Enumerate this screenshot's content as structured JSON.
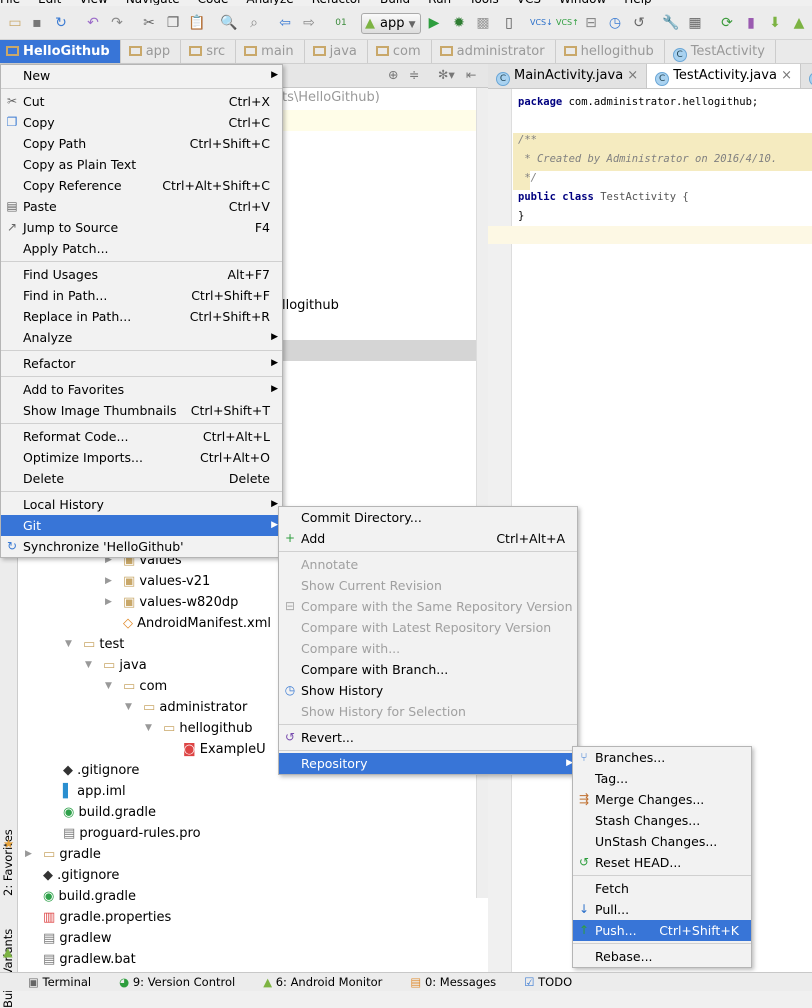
{
  "menubar": [
    "File",
    "Edit",
    "View",
    "Navigate",
    "Code",
    "Analyze",
    "Refactor",
    "Build",
    "Run",
    "Tools",
    "VCS",
    "Window",
    "Help"
  ],
  "toolbar": {
    "run_config": "app"
  },
  "breadcrumb": [
    "HelloGithub",
    "app",
    "src",
    "main",
    "java",
    "com",
    "administrator",
    "hellogithub",
    "TestActivity"
  ],
  "editor": {
    "tabs": [
      {
        "label": "MainActivity.java",
        "active": false
      },
      {
        "label": "TestActivity.java",
        "active": true
      },
      {
        "label": "c",
        "active": false
      }
    ],
    "lines": {
      "pkg_kw": "package",
      "pkg": " com.administrator.hellogithub;",
      "c1": "/**",
      "c2": " * Created by Administrator on 2016/4/10.",
      "c3": " */",
      "pub": "public",
      "cls": "class",
      "name": " TestActivity {",
      "close": "}"
    }
  },
  "project": {
    "path_fragment": "ts\\HelloGithub)",
    "pkg_fragment": "llogithub",
    "tree": [
      {
        "label": "values",
        "type": "res-folder",
        "depth": 5,
        "arrow": "right"
      },
      {
        "label": "values-v21",
        "type": "res-folder",
        "depth": 5,
        "arrow": "right"
      },
      {
        "label": "values-w820dp",
        "type": "res-folder",
        "depth": 5,
        "arrow": "right"
      },
      {
        "label": "AndroidManifest.xml",
        "type": "xml",
        "depth": 5
      },
      {
        "label": "test",
        "type": "folder",
        "depth": 3,
        "arrow": "down"
      },
      {
        "label": "java",
        "type": "folder",
        "depth": 4,
        "arrow": "down"
      },
      {
        "label": "com",
        "type": "folder",
        "depth": 5,
        "arrow": "down"
      },
      {
        "label": "administrator",
        "type": "folder",
        "depth": 6,
        "arrow": "down"
      },
      {
        "label": "hellogithub",
        "type": "folder",
        "depth": 7,
        "arrow": "down"
      },
      {
        "label": "ExampleU",
        "type": "test-class",
        "depth": 8
      },
      {
        "label": ".gitignore",
        "type": "git",
        "depth": 2
      },
      {
        "label": "app.iml",
        "type": "iml",
        "depth": 2
      },
      {
        "label": "build.gradle",
        "type": "gradle",
        "depth": 2
      },
      {
        "label": "proguard-rules.pro",
        "type": "file",
        "depth": 2
      },
      {
        "label": "gradle",
        "type": "folder",
        "depth": 1,
        "arrow": "right"
      },
      {
        "label": ".gitignore",
        "type": "git",
        "depth": 1
      },
      {
        "label": "build.gradle",
        "type": "gradle",
        "depth": 1
      },
      {
        "label": "gradle.properties",
        "type": "props",
        "depth": 1
      },
      {
        "label": "gradlew",
        "type": "file",
        "depth": 1
      },
      {
        "label": "gradlew.bat",
        "type": "file",
        "depth": 1
      }
    ]
  },
  "side_tabs": {
    "favorites": "2: Favorites",
    "build_variants": "Build Variants"
  },
  "context_menu": [
    {
      "label": "New",
      "submenu": true
    },
    "-",
    {
      "label": "Cut",
      "shortcut": "Ctrl+X",
      "icon": "scissors-icon"
    },
    {
      "label": "Copy",
      "shortcut": "Ctrl+C",
      "icon": "copy-icon"
    },
    {
      "label": "Copy Path",
      "shortcut": "Ctrl+Shift+C"
    },
    {
      "label": "Copy as Plain Text"
    },
    {
      "label": "Copy Reference",
      "shortcut": "Ctrl+Alt+Shift+C"
    },
    {
      "label": "Paste",
      "shortcut": "Ctrl+V",
      "icon": "paste-icon"
    },
    {
      "label": "Jump to Source",
      "shortcut": "F4",
      "icon": "jump-icon"
    },
    {
      "label": "Apply Patch..."
    },
    "-",
    {
      "label": "Find Usages",
      "shortcut": "Alt+F7"
    },
    {
      "label": "Find in Path...",
      "shortcut": "Ctrl+Shift+F"
    },
    {
      "label": "Replace in Path...",
      "shortcut": "Ctrl+Shift+R"
    },
    {
      "label": "Analyze",
      "submenu": true
    },
    "-",
    {
      "label": "Refactor",
      "submenu": true
    },
    "-",
    {
      "label": "Add to Favorites",
      "submenu": true
    },
    {
      "label": "Show Image Thumbnails",
      "shortcut": "Ctrl+Shift+T"
    },
    "-",
    {
      "label": "Reformat Code...",
      "shortcut": "Ctrl+Alt+L"
    },
    {
      "label": "Optimize Imports...",
      "shortcut": "Ctrl+Alt+O"
    },
    {
      "label": "Delete",
      "shortcut": "Delete"
    },
    "-",
    {
      "label": "Local History",
      "submenu": true
    },
    {
      "label": "Git",
      "submenu": true,
      "highlighted": true
    },
    {
      "label": "Synchronize 'HelloGithub'",
      "icon": "sync-icon"
    }
  ],
  "git_menu": [
    {
      "label": "Commit Directory..."
    },
    {
      "label": "Add",
      "shortcut": "Ctrl+Alt+A",
      "icon": "plus-icon"
    },
    "-",
    {
      "label": "Annotate",
      "disabled": true
    },
    {
      "label": "Show Current Revision",
      "disabled": true
    },
    {
      "label": "Compare with the Same Repository Version",
      "disabled": true,
      "icon": "compare-icon"
    },
    {
      "label": "Compare with Latest Repository Version",
      "disabled": true
    },
    {
      "label": "Compare with...",
      "disabled": true
    },
    {
      "label": "Compare with Branch..."
    },
    {
      "label": "Show History",
      "icon": "history-icon"
    },
    {
      "label": "Show History for Selection",
      "disabled": true
    },
    "-",
    {
      "label": "Revert...",
      "icon": "revert-icon"
    },
    "-",
    {
      "label": "Repository",
      "submenu": true,
      "highlighted": true
    }
  ],
  "repository_menu": [
    {
      "label": "Branches...",
      "icon": "branch-icon"
    },
    {
      "label": "Tag..."
    },
    {
      "label": "Merge Changes...",
      "icon": "merge-icon"
    },
    {
      "label": "Stash Changes..."
    },
    {
      "label": "UnStash Changes..."
    },
    {
      "label": "Reset HEAD...",
      "icon": "reset-icon"
    },
    "-",
    {
      "label": "Fetch"
    },
    {
      "label": "Pull...",
      "icon": "vcs-pull-icon"
    },
    {
      "label": "Push...",
      "shortcut": "Ctrl+Shift+K",
      "icon": "vcs-push-icon",
      "highlighted": true
    },
    "-",
    {
      "label": "Rebase..."
    }
  ],
  "bottom_tabs": [
    "Terminal",
    "9: Version Control",
    "6: Android Monitor",
    "0: Messages",
    "TODO"
  ],
  "colors": {
    "highlight": "#3875d7",
    "keyword": "#000080",
    "comment": "#808080",
    "menu_bg": "#f2f2f2"
  }
}
